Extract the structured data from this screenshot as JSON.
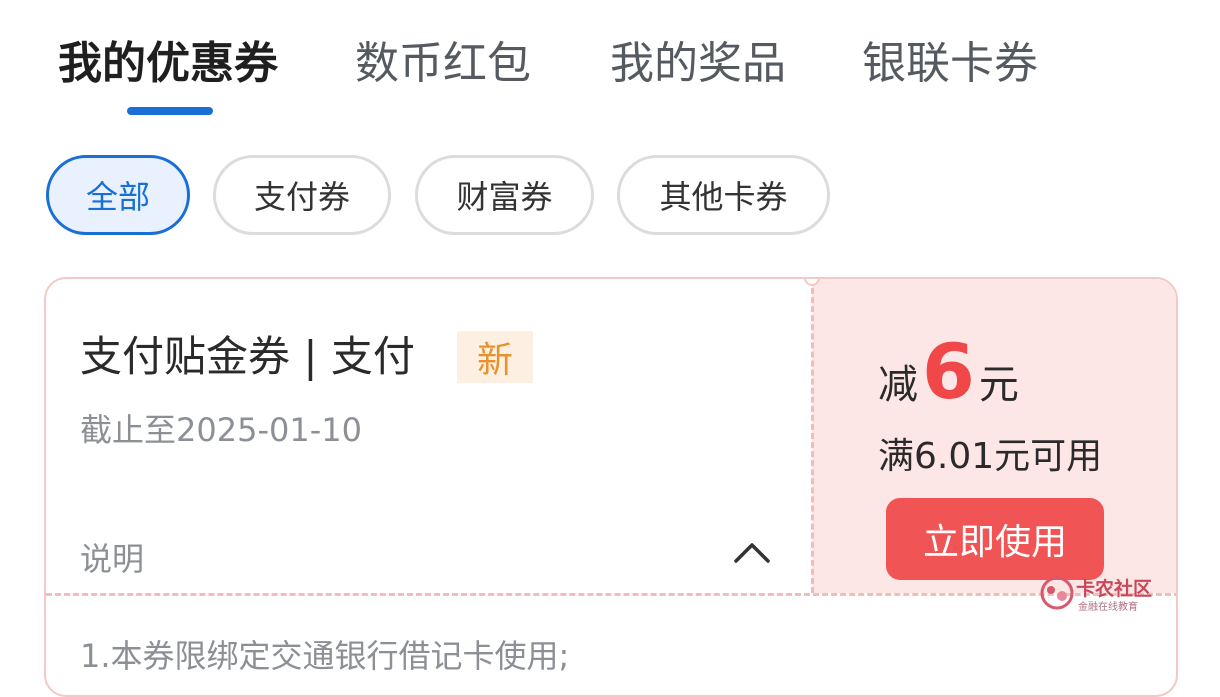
{
  "tabs": [
    {
      "label": "我的优惠券",
      "active": true
    },
    {
      "label": "数币红包",
      "active": false
    },
    {
      "label": "我的奖品",
      "active": false
    },
    {
      "label": "银联卡券",
      "active": false
    }
  ],
  "filters": [
    {
      "label": "全部",
      "active": true
    },
    {
      "label": "支付券",
      "active": false
    },
    {
      "label": "财富券",
      "active": false
    },
    {
      "label": "其他卡券",
      "active": false
    }
  ],
  "coupon": {
    "title": "支付贴金券 | 支付",
    "badge": "新",
    "expiry": "截止至2025-01-10",
    "amount_prefix": "减",
    "amount_value": "6",
    "amount_unit": "元",
    "condition": "满6.01元可用",
    "use_button": "立即使用",
    "description_label": "说明",
    "description_text": "1.本券限绑定交通银行借记卡使用;",
    "chevron_icon": "chevron-up-icon"
  },
  "watermark": {
    "name": "卡农社区",
    "subtitle": "金融在线教育"
  },
  "colors": {
    "accent_blue": "#1a6fd6",
    "coupon_red": "#f04848",
    "coupon_bg": "#fde7e6",
    "badge_orange": "#e8912f"
  }
}
